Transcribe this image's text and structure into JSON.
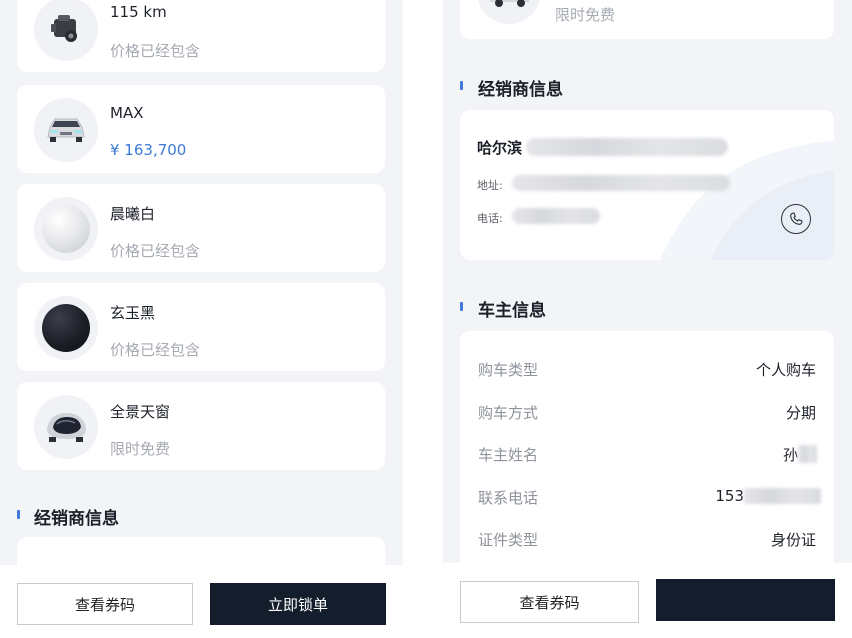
{
  "left": {
    "items": [
      {
        "title": "115 km",
        "subtitle": "价格已经包含",
        "icon": "motor-icon",
        "subtitle_type": "note"
      },
      {
        "title": "MAX",
        "subtitle": "¥ 163,700",
        "icon": "car-front-icon",
        "subtitle_type": "price"
      },
      {
        "title": "晨曦白",
        "subtitle": "价格已经包含",
        "icon": "white-color-swatch-icon",
        "subtitle_type": "note"
      },
      {
        "title": "玄玉黑",
        "subtitle": "价格已经包含",
        "icon": "black-color-swatch-icon",
        "subtitle_type": "note"
      },
      {
        "title": "全景天窗",
        "subtitle": "限时免费",
        "icon": "panoramic-sunroof-icon",
        "subtitle_type": "note"
      }
    ],
    "dealer_section_title": "经销商信息",
    "buttons": {
      "view_code": "查看券码",
      "lock_order": "立即锁单"
    }
  },
  "right": {
    "top_item_subtitle": "限时免费",
    "dealer_section_title": "经销商信息",
    "dealer": {
      "name_prefix": "哈尔滨",
      "address_label": "地址:",
      "phone_label": "电话:"
    },
    "owner_section_title": "车主信息",
    "owner_rows": [
      {
        "label": "购车类型",
        "value": "个人购车"
      },
      {
        "label": "购车方式",
        "value": "分期"
      },
      {
        "label": "车主姓名",
        "value": "孙"
      },
      {
        "label": "联系电话",
        "value": "153"
      },
      {
        "label": "证件类型",
        "value": "身份证"
      }
    ],
    "buttons": {
      "view_code": "查看券码"
    }
  },
  "colors": {
    "accent": "#3f78d8",
    "price": "#3d7ad9",
    "dark_button": "#141d2b",
    "background": "#f3f4f8"
  }
}
